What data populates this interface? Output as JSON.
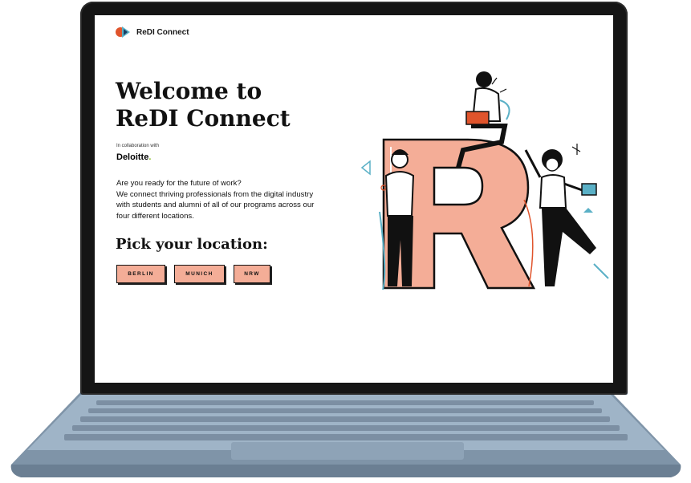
{
  "brand": {
    "name": "ReDI Connect",
    "accent": "#f4ad97",
    "logo_colors": [
      "#e0542c",
      "#5ab0c6"
    ]
  },
  "hero": {
    "headline": "Welcome to ReDI Connect",
    "collab_label": "In collaboration with",
    "partner_name": "Deloitte",
    "partner_dot": ".",
    "intro_lines": [
      "Are you ready for the future of work?",
      "We connect thriving professionals from the digital industry with students and alumni of all of our programs across our four different locations."
    ]
  },
  "location_picker": {
    "title": "Pick your location:",
    "options": [
      "BERLIN",
      "MUNICH",
      "NRW"
    ]
  },
  "illustration": {
    "letter": "R",
    "icon": "people-around-letter-illustration"
  }
}
